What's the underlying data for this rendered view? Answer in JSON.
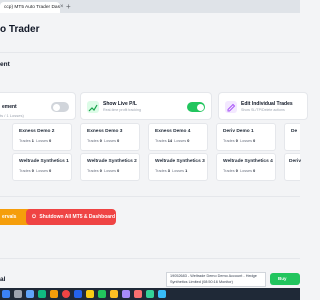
{
  "browser": {
    "tab_title": "ccp) MT5 Auto Trader Das",
    "close_glyph": "×",
    "new_tab_glyph": "+"
  },
  "app": {
    "title": "o Trader"
  },
  "settings_section": {
    "title": "ent",
    "options": [
      {
        "title": "ement",
        "desc": "",
        "toggle_on": false
      },
      {
        "title": "Show Live P/L",
        "desc": "Real-time profit tracking",
        "toggle_on": true
      },
      {
        "title": "Edit Individual Trades",
        "desc": "Show SL/TP/Delete actions",
        "toggle_on": null
      }
    ]
  },
  "accounts": {
    "label": "ts / 1 Losses)",
    "trades_label": "Trades",
    "losses_label": "Losses",
    "cards": [
      {
        "name": "Exness Demo 2",
        "trades": "1",
        "losses": "0"
      },
      {
        "name": "Exness Demo 3",
        "trades": "0",
        "losses": "0"
      },
      {
        "name": "Exness Demo 4",
        "trades": "14",
        "losses": "0"
      },
      {
        "name": "Deriv Demo 1",
        "trades": "0",
        "losses": "0"
      },
      {
        "name": "De",
        "trades": "",
        "losses": ""
      },
      {
        "name": "Weltrade Synthetics 1",
        "trades": "0",
        "losses": "0"
      },
      {
        "name": "Weltrade Synthetics 2",
        "trades": "0",
        "losses": "0"
      },
      {
        "name": "Weltrade Synthetics 3",
        "trades": "3",
        "losses": "1"
      },
      {
        "name": "Weltrade Synthetics 4",
        "trades": "0",
        "losses": "0"
      },
      {
        "name": "Deriv",
        "trades": "",
        "losses": ""
      }
    ]
  },
  "actions": {
    "left_button": "ervals",
    "shutdown_button": "Shutdown All MT5 & Dashboard"
  },
  "bottom_section": {
    "title": "al"
  },
  "tooltip": {
    "line1": "19052683 - Weltrade Demo Demo Account - Hedge",
    "line2": "Synthetics Limited  (08:50:16 Monitor)"
  },
  "buy_button": "Buy",
  "colors": {
    "toggle_off": "#d1d5db",
    "toggle_on": "#22c55e",
    "orange": "#f59e0b",
    "red": "#ef4444",
    "green": "#22c55e",
    "purple": "#a855f7"
  }
}
